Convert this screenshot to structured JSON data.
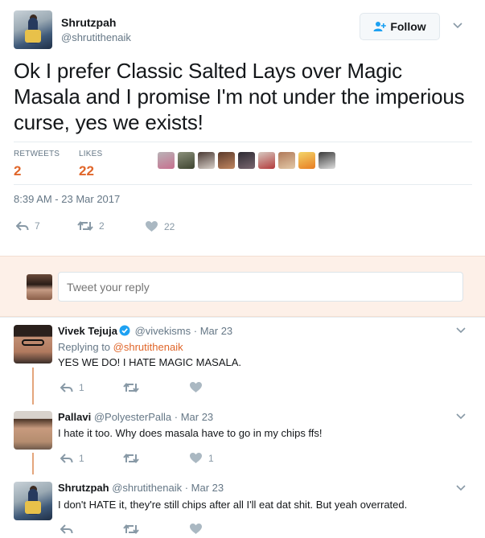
{
  "tweet": {
    "author_name": "Shrutzpah",
    "author_handle": "@shrutithenaik",
    "follow_label": "Follow",
    "text": "Ok I prefer Classic Salted Lays over Magic Masala and I promise I'm not under the imperious curse, yes we exists!",
    "retweets_label": "RETWEETS",
    "retweets_count": "2",
    "likes_label": "LIKES",
    "likes_count": "22",
    "timestamp": "8:39 AM - 23 Mar 2017",
    "action_reply_count": "7",
    "action_retweet_count": "2",
    "action_like_count": "22",
    "likers": [
      {
        "colors": [
          "#b9b3b7",
          "#c7708f"
        ]
      },
      {
        "colors": [
          "#8a8f7a",
          "#3e4430"
        ]
      },
      {
        "colors": [
          "#4a3a34",
          "#d8d0c9"
        ]
      },
      {
        "colors": [
          "#5c3b2c",
          "#c08660"
        ]
      },
      {
        "colors": [
          "#2d2b33",
          "#7a6770"
        ]
      },
      {
        "colors": [
          "#d6c8c0",
          "#b33a3a"
        ]
      },
      {
        "colors": [
          "#b07a5a",
          "#e3c9a8"
        ]
      },
      {
        "colors": [
          "#f3d56a",
          "#e87d22"
        ]
      },
      {
        "colors": [
          "#3a3a3a",
          "#dedede"
        ]
      }
    ]
  },
  "reply_box": {
    "placeholder": "Tweet your reply"
  },
  "replies": [
    {
      "name": "Vivek Tejuja",
      "verified": true,
      "handle": "@vivekisms",
      "date": "Mar 23",
      "replying_prefix": "Replying to",
      "replying_to": "@shrutithenaik",
      "text": "YES WE DO! I HATE MAGIC MASALA.",
      "reply_count": "1",
      "retweet_count": "",
      "like_count": ""
    },
    {
      "name": "Pallavi",
      "verified": false,
      "handle": "@PolyesterPalla",
      "date": "Mar 23",
      "text": "I hate it too. Why does masala have to go in my chips ffs!",
      "reply_count": "1",
      "retweet_count": "",
      "like_count": "1"
    },
    {
      "name": "Shrutzpah",
      "verified": false,
      "handle": "@shrutithenaik",
      "date": "Mar 23",
      "text": "I don't HATE it, they're still chips after all I'll eat dat shit. But yeah overrated.",
      "reply_count": "",
      "retweet_count": "",
      "like_count": ""
    }
  ],
  "colors": {
    "accent": "#e0662a",
    "thread_line": "#e4a57c",
    "reply_box_bg": "#fdf0e8",
    "muted": "#657786"
  }
}
